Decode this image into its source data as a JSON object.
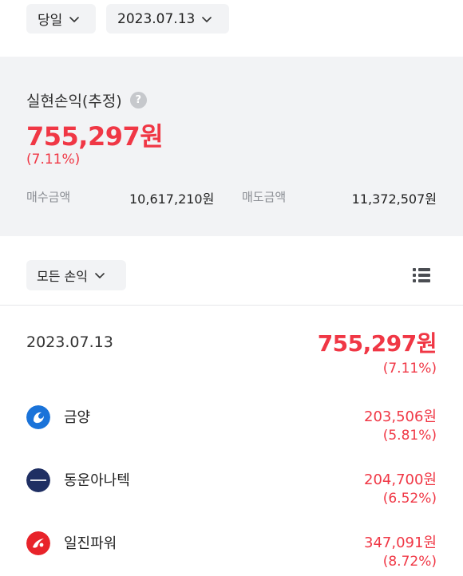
{
  "filters": {
    "period_label": "당일",
    "date_label": "2023.07.13"
  },
  "summary": {
    "title": "실현손익(추정)",
    "help_glyph": "?",
    "amount": "755,297원",
    "rate": "(7.11%)",
    "buy_label": "매수금액",
    "buy_value": "10,617,210원",
    "sell_label": "매도금액",
    "sell_value": "11,372,507원"
  },
  "list_filter": {
    "label": "모든 손익"
  },
  "day": {
    "date": "2023.07.13",
    "total": "755,297원",
    "rate": "(7.11%)"
  },
  "stocks": [
    {
      "name": "금양",
      "amount": "203,506원",
      "rate": "(5.81%)",
      "logo_color": "#1a73d9",
      "icon": "kumyang-logo-icon"
    },
    {
      "name": "동운아나텍",
      "amount": "204,700원",
      "rate": "(6.52%)",
      "logo_color": "#1f2f63",
      "icon": "dongwoon-anatech-logo-icon"
    },
    {
      "name": "일진파워",
      "amount": "347,091원",
      "rate": "(8.72%)",
      "logo_color": "#e8232a",
      "icon": "iljin-power-logo-icon"
    }
  ],
  "colors": {
    "profit": "#f03745",
    "panel_bg": "#f2f3f5",
    "muted_text": "#8a8d93"
  }
}
